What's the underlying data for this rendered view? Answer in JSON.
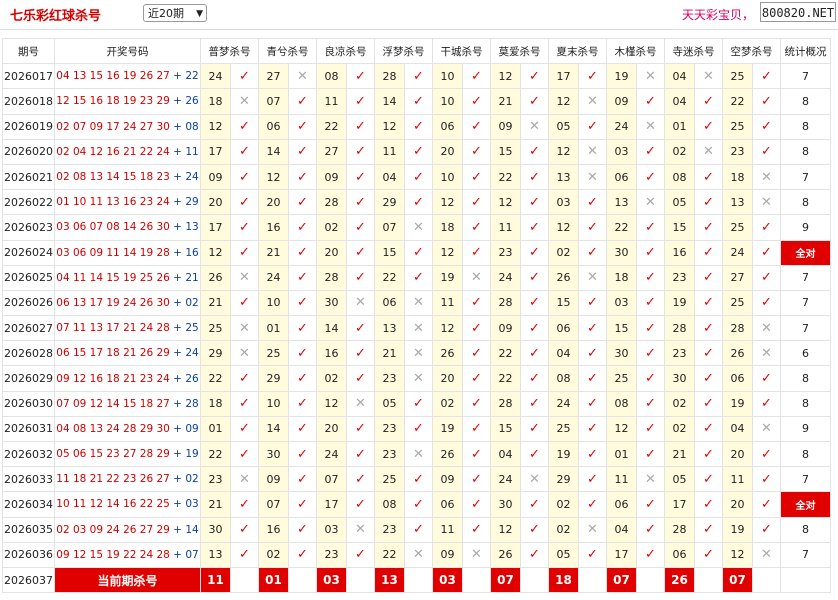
{
  "header": {
    "title": "七乐彩红球杀号",
    "period_selected": "近20期",
    "slogan": "天天彩宝贝，",
    "site": "800820.NET"
  },
  "columns": [
    "期号",
    "开奖号码",
    "普梦杀号",
    "青兮杀号",
    "良凉杀号",
    "浮梦杀号",
    "干城杀号",
    "莫爱杀号",
    "夏末杀号",
    "木槿杀号",
    "寺迷杀号",
    "空梦杀号",
    "统计概况"
  ],
  "rows": [
    {
      "issue": "2026017",
      "red": "04 13 15 16 19 26 27",
      "blue": "22",
      "kills": [
        [
          "24",
          1
        ],
        [
          "27",
          0
        ],
        [
          "08",
          1
        ],
        [
          "28",
          1
        ],
        [
          "10",
          1
        ],
        [
          "12",
          1
        ],
        [
          "17",
          1
        ],
        [
          "19",
          0
        ],
        [
          "04",
          0
        ],
        [
          "25",
          1
        ]
      ],
      "stat": "7"
    },
    {
      "issue": "2026018",
      "red": "12 15 16 18 19 23 29",
      "blue": "26",
      "kills": [
        [
          "18",
          0
        ],
        [
          "07",
          1
        ],
        [
          "11",
          1
        ],
        [
          "14",
          1
        ],
        [
          "10",
          1
        ],
        [
          "21",
          1
        ],
        [
          "12",
          0
        ],
        [
          "09",
          1
        ],
        [
          "04",
          1
        ],
        [
          "22",
          1
        ]
      ],
      "stat": "8"
    },
    {
      "issue": "2026019",
      "red": "02 07 09 17 24 27 30",
      "blue": "08",
      "kills": [
        [
          "12",
          1
        ],
        [
          "06",
          1
        ],
        [
          "22",
          1
        ],
        [
          "12",
          1
        ],
        [
          "06",
          1
        ],
        [
          "09",
          0
        ],
        [
          "05",
          1
        ],
        [
          "24",
          0
        ],
        [
          "01",
          1
        ],
        [
          "25",
          1
        ]
      ],
      "stat": "8"
    },
    {
      "issue": "2026020",
      "red": "02 04 12 16 21 22 24",
      "blue": "11",
      "kills": [
        [
          "17",
          1
        ],
        [
          "14",
          1
        ],
        [
          "27",
          1
        ],
        [
          "11",
          1
        ],
        [
          "20",
          1
        ],
        [
          "15",
          1
        ],
        [
          "12",
          0
        ],
        [
          "03",
          1
        ],
        [
          "02",
          0
        ],
        [
          "23",
          1
        ]
      ],
      "stat": "8"
    },
    {
      "issue": "2026021",
      "red": "02 08 13 14 15 18 23",
      "blue": "24",
      "kills": [
        [
          "09",
          1
        ],
        [
          "12",
          1
        ],
        [
          "09",
          1
        ],
        [
          "04",
          1
        ],
        [
          "10",
          1
        ],
        [
          "22",
          1
        ],
        [
          "13",
          0
        ],
        [
          "06",
          1
        ],
        [
          "08",
          1
        ],
        [
          "18",
          0
        ]
      ],
      "stat": "7"
    },
    {
      "issue": "2026022",
      "red": "01 10 11 13 16 23 24",
      "blue": "29",
      "kills": [
        [
          "20",
          1
        ],
        [
          "20",
          1
        ],
        [
          "28",
          1
        ],
        [
          "29",
          1
        ],
        [
          "12",
          1
        ],
        [
          "12",
          1
        ],
        [
          "03",
          1
        ],
        [
          "13",
          0
        ],
        [
          "05",
          1
        ],
        [
          "13",
          0
        ]
      ],
      "stat": "8"
    },
    {
      "issue": "2026023",
      "red": "03 06 07 08 14 26 30",
      "blue": "13",
      "kills": [
        [
          "17",
          1
        ],
        [
          "16",
          1
        ],
        [
          "02",
          1
        ],
        [
          "07",
          0
        ],
        [
          "18",
          1
        ],
        [
          "11",
          1
        ],
        [
          "12",
          1
        ],
        [
          "22",
          1
        ],
        [
          "15",
          1
        ],
        [
          "25",
          1
        ]
      ],
      "stat": "9"
    },
    {
      "issue": "2026024",
      "red": "03 06 09 11 14 19 28",
      "blue": "16",
      "kills": [
        [
          "12",
          1
        ],
        [
          "21",
          1
        ],
        [
          "20",
          1
        ],
        [
          "15",
          1
        ],
        [
          "12",
          1
        ],
        [
          "23",
          1
        ],
        [
          "02",
          1
        ],
        [
          "30",
          1
        ],
        [
          "16",
          1
        ],
        [
          "24",
          1
        ]
      ],
      "stat": "全对"
    },
    {
      "issue": "2026025",
      "red": "04 11 14 15 19 25 26",
      "blue": "21",
      "kills": [
        [
          "26",
          0
        ],
        [
          "24",
          1
        ],
        [
          "28",
          1
        ],
        [
          "22",
          1
        ],
        [
          "19",
          0
        ],
        [
          "24",
          1
        ],
        [
          "26",
          0
        ],
        [
          "18",
          1
        ],
        [
          "23",
          1
        ],
        [
          "27",
          1
        ]
      ],
      "stat": "7"
    },
    {
      "issue": "2026026",
      "red": "06 13 17 19 24 26 30",
      "blue": "02",
      "kills": [
        [
          "21",
          1
        ],
        [
          "10",
          1
        ],
        [
          "30",
          0
        ],
        [
          "06",
          0
        ],
        [
          "11",
          1
        ],
        [
          "28",
          1
        ],
        [
          "15",
          1
        ],
        [
          "03",
          1
        ],
        [
          "19",
          1
        ],
        [
          "25",
          1
        ]
      ],
      "stat": "7"
    },
    {
      "issue": "2026027",
      "red": "07 11 13 17 21 24 28",
      "blue": "25",
      "kills": [
        [
          "25",
          0
        ],
        [
          "01",
          1
        ],
        [
          "14",
          1
        ],
        [
          "13",
          0
        ],
        [
          "12",
          1
        ],
        [
          "09",
          1
        ],
        [
          "06",
          1
        ],
        [
          "15",
          1
        ],
        [
          "28",
          1
        ],
        [
          "28",
          0
        ]
      ],
      "stat": "7"
    },
    {
      "issue": "2026028",
      "red": "06 15 17 18 21 26 29",
      "blue": "24",
      "kills": [
        [
          "29",
          0
        ],
        [
          "25",
          1
        ],
        [
          "16",
          1
        ],
        [
          "21",
          0
        ],
        [
          "26",
          1
        ],
        [
          "22",
          1
        ],
        [
          "04",
          1
        ],
        [
          "30",
          1
        ],
        [
          "23",
          1
        ],
        [
          "26",
          0
        ]
      ],
      "stat": "6"
    },
    {
      "issue": "2026029",
      "red": "09 12 16 18 21 23 24",
      "blue": "26",
      "kills": [
        [
          "22",
          1
        ],
        [
          "29",
          1
        ],
        [
          "02",
          1
        ],
        [
          "23",
          0
        ],
        [
          "20",
          1
        ],
        [
          "22",
          1
        ],
        [
          "08",
          1
        ],
        [
          "25",
          1
        ],
        [
          "30",
          1
        ],
        [
          "06",
          1
        ]
      ],
      "stat": "8"
    },
    {
      "issue": "2026030",
      "red": "07 09 12 14 15 18 27",
      "blue": "28",
      "kills": [
        [
          "18",
          1
        ],
        [
          "10",
          1
        ],
        [
          "12",
          0
        ],
        [
          "05",
          1
        ],
        [
          "02",
          1
        ],
        [
          "28",
          1
        ],
        [
          "24",
          1
        ],
        [
          "08",
          1
        ],
        [
          "02",
          1
        ],
        [
          "19",
          1
        ]
      ],
      "stat": "8"
    },
    {
      "issue": "2026031",
      "red": "04 08 13 24 28 29 30",
      "blue": "09",
      "kills": [
        [
          "01",
          1
        ],
        [
          "14",
          1
        ],
        [
          "20",
          1
        ],
        [
          "23",
          1
        ],
        [
          "19",
          1
        ],
        [
          "15",
          1
        ],
        [
          "25",
          1
        ],
        [
          "12",
          1
        ],
        [
          "02",
          1
        ],
        [
          "04",
          0
        ]
      ],
      "stat": "9"
    },
    {
      "issue": "2026032",
      "red": "05 06 15 23 27 28 29",
      "blue": "19",
      "kills": [
        [
          "22",
          1
        ],
        [
          "30",
          1
        ],
        [
          "24",
          1
        ],
        [
          "23",
          0
        ],
        [
          "26",
          1
        ],
        [
          "04",
          1
        ],
        [
          "19",
          1
        ],
        [
          "01",
          1
        ],
        [
          "21",
          1
        ],
        [
          "20",
          1
        ]
      ],
      "stat": "8"
    },
    {
      "issue": "2026033",
      "red": "11 18 21 22 23 26 27",
      "blue": "02",
      "kills": [
        [
          "23",
          0
        ],
        [
          "09",
          1
        ],
        [
          "07",
          1
        ],
        [
          "25",
          1
        ],
        [
          "09",
          1
        ],
        [
          "24",
          0
        ],
        [
          "29",
          1
        ],
        [
          "11",
          0
        ],
        [
          "05",
          1
        ],
        [
          "11",
          1
        ]
      ],
      "stat": "7"
    },
    {
      "issue": "2026034",
      "red": "10 11 12 14 16 22 25",
      "blue": "03",
      "kills": [
        [
          "21",
          1
        ],
        [
          "07",
          1
        ],
        [
          "17",
          1
        ],
        [
          "08",
          1
        ],
        [
          "06",
          1
        ],
        [
          "30",
          1
        ],
        [
          "02",
          1
        ],
        [
          "06",
          1
        ],
        [
          "17",
          1
        ],
        [
          "20",
          1
        ]
      ],
      "stat": "全对"
    },
    {
      "issue": "2026035",
      "red": "02 03 09 24 26 27 29",
      "blue": "14",
      "kills": [
        [
          "30",
          1
        ],
        [
          "16",
          1
        ],
        [
          "03",
          0
        ],
        [
          "23",
          1
        ],
        [
          "11",
          1
        ],
        [
          "12",
          1
        ],
        [
          "02",
          0
        ],
        [
          "04",
          1
        ],
        [
          "28",
          1
        ],
        [
          "19",
          1
        ]
      ],
      "stat": "8"
    },
    {
      "issue": "2026036",
      "red": "09 12 15 19 22 24 28",
      "blue": "07",
      "kills": [
        [
          "13",
          1
        ],
        [
          "02",
          1
        ],
        [
          "23",
          1
        ],
        [
          "22",
          0
        ],
        [
          "09",
          0
        ],
        [
          "26",
          1
        ],
        [
          "05",
          1
        ],
        [
          "17",
          1
        ],
        [
          "06",
          1
        ],
        [
          "12",
          0
        ]
      ],
      "stat": "7"
    }
  ],
  "current": {
    "issue": "2026037",
    "label": "当前期杀号",
    "kills": [
      "11",
      "01",
      "03",
      "13",
      "03",
      "07",
      "18",
      "07",
      "26",
      "07"
    ]
  },
  "marks": {
    "ok": "✓",
    "no": "✕"
  },
  "colors": {
    "accent": "#e00000",
    "blue_ball": "#0b3fa3",
    "kill_bg": "#fffbdc"
  }
}
